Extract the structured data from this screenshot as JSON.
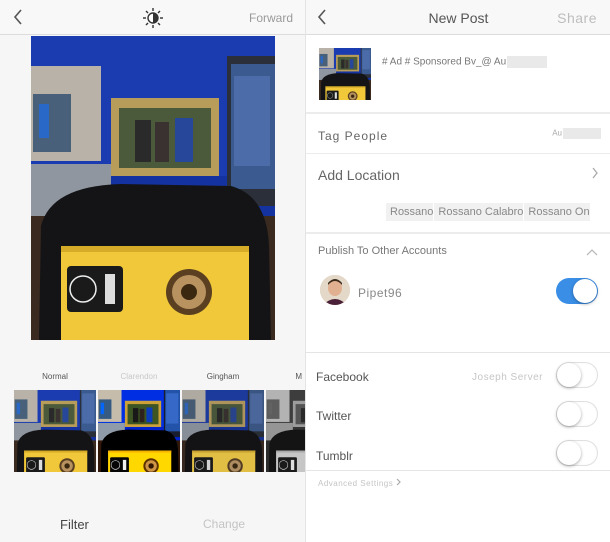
{
  "editor": {
    "header": {
      "back_icon": "chevron-left-icon",
      "center_icon": "brightness-icon",
      "forward_label": "Forward"
    },
    "filters": [
      {
        "label": "Normal",
        "active": true
      },
      {
        "label": "Clarendon",
        "active": false
      },
      {
        "label": "Gingham",
        "active": false
      },
      {
        "label": "M",
        "active": false
      }
    ],
    "bottom_tabs": {
      "filter": "Filter",
      "change": "Change"
    }
  },
  "new_post": {
    "header": {
      "back_icon": "chevron-left-icon",
      "title": "New Post",
      "share_label": "Share"
    },
    "caption": "# Ad # Sponsored Bv_@ Au",
    "tag_people": {
      "label": "Tag People",
      "value": "Au"
    },
    "location": {
      "label": "Add Location",
      "suggestions": [
        "Rossano",
        "Rossano Calabro",
        "Rossano On"
      ]
    },
    "publish_section": {
      "title": "Publish To Other Accounts",
      "account": {
        "name": "Pipet96",
        "enabled": true
      }
    },
    "social": [
      {
        "label": "Facebook",
        "sub": "Joseph Server",
        "enabled": false
      },
      {
        "label": "Twitter",
        "sub": "",
        "enabled": false
      },
      {
        "label": "Tumblr",
        "sub": "",
        "enabled": false
      }
    ],
    "advanced_label": "Advanced Settings",
    "colors": {
      "toggle_on": "#3a8ee6",
      "toggle_off": "#ffffff"
    }
  }
}
